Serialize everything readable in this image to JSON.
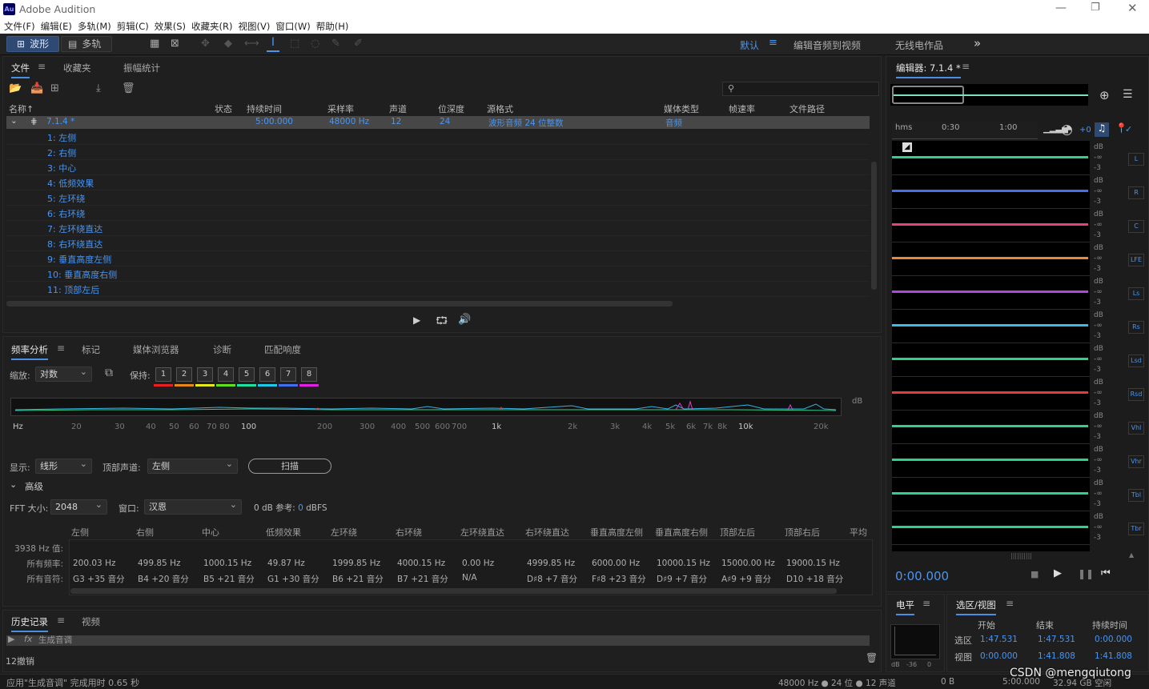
{
  "app": {
    "logo": "Au",
    "title": "Adobe Audition"
  },
  "menu": [
    "文件(F)",
    "编辑(E)",
    "多轨(M)",
    "剪辑(C)",
    "效果(S)",
    "收藏夹(R)",
    "视图(V)",
    "窗口(W)",
    "帮助(H)"
  ],
  "toolbar": {
    "waveform": "波形",
    "multitrack": "多轨",
    "workspace_default": "默认",
    "workspace_edit_video": "编辑音频到视频",
    "workspace_radio": "无线电作品",
    "more": "»"
  },
  "files_panel": {
    "tabs": [
      "文件",
      "收藏夹",
      "振幅统计"
    ],
    "columns": [
      "名称↑",
      "状态",
      "持续时间",
      "采样率",
      "声道",
      "位深度",
      "源格式",
      "媒体类型",
      "帧速率",
      "文件路径"
    ],
    "main_row": {
      "name": "7.1.4 *",
      "duration": "5:00.000",
      "rate": "48000 Hz",
      "channels": "12",
      "depth": "24",
      "format": "波形音频 24 位整数",
      "type": "音频"
    },
    "channels": [
      "1: 左侧",
      "2: 右侧",
      "3: 中心",
      "4: 低频效果",
      "5: 左环绕",
      "6: 右环绕",
      "7: 左环绕直达",
      "8: 右环绕直达",
      "9: 垂直高度左侧",
      "10: 垂直高度右侧",
      "11: 顶部左后"
    ]
  },
  "freq_panel": {
    "tabs": [
      "频率分析",
      "标记",
      "媒体浏览器",
      "诊断",
      "匹配响度"
    ],
    "scale_label": "缩放:",
    "scale_value": "对数",
    "hold_label": "保持:",
    "hold_buttons": [
      "1",
      "2",
      "3",
      "4",
      "5",
      "6",
      "7",
      "8"
    ],
    "axis_ticks": [
      "Hz",
      "20",
      "30",
      "40",
      "50",
      "60",
      "70",
      "80",
      "100",
      "200",
      "300",
      "400",
      "500",
      "600",
      "700",
      "1k",
      "2k",
      "3k",
      "4k",
      "5k",
      "6k",
      "7k",
      "8k",
      "10k",
      "20k"
    ],
    "db_label": "dB",
    "display_label": "显示:",
    "display_value": "线形",
    "top_channel_label": "顶部声道:",
    "top_channel_value": "左侧",
    "scan": "扫描",
    "advanced": "高级",
    "fft_label": "FFT 大小:",
    "fft_value": "2048",
    "window_label": "窗口:",
    "window_value": "汉恩",
    "ref_label": "0 dB 参考:",
    "ref_value": "0",
    "ref_unit": "dBFS",
    "table_headers": [
      "左侧",
      "右侧",
      "中心",
      "低频效果",
      "左环绕",
      "右环绕",
      "左环绕直达",
      "右环绕直达",
      "垂直高度左侧",
      "垂直高度右侧",
      "顶部左后",
      "顶部右后",
      "平均"
    ],
    "row_labels": [
      "3938 Hz 值:",
      "所有频率:",
      "所有音符:"
    ],
    "freqs": [
      "200.03 Hz",
      "499.85 Hz",
      "1000.15 Hz",
      "49.87 Hz",
      "1999.85 Hz",
      "4000.15 Hz",
      "0.00 Hz",
      "4999.85 Hz",
      "6000.00 Hz",
      "10000.15 Hz",
      "15000.00 Hz",
      "19000.15 Hz"
    ],
    "notes": [
      "G3 +35 音分",
      "B4 +20 音分",
      "B5 +21 音分",
      "G1 +30 音分",
      "B6 +21 音分",
      "B7 +21 音分",
      "N/A",
      "D♯8 +7 音分",
      "F♯8 +23 音分",
      "D♯9 +7 音分",
      "A♯9 +9 音分",
      "D10 +18 音分"
    ]
  },
  "history_panel": {
    "tabs": [
      "历史记录",
      "视频"
    ],
    "item": "生成音调",
    "undo": "12撤销"
  },
  "status": {
    "message": "应用\"生成音调\" 完成用时 0.65 秒",
    "format": "48000 Hz ● 24 位 ● 12 声道",
    "size": "0 B",
    "duration": "5:00.000",
    "free": "32.94 GB 空闲"
  },
  "editor": {
    "title": "编辑器: 7.1.4 *",
    "ruler": [
      "hms",
      "0:30",
      "1:00"
    ],
    "gain": "+0",
    "time": "0:00.000",
    "db_lines": [
      "dB",
      "-∞",
      "-3"
    ],
    "channels": [
      {
        "label": "L",
        "color": "#2fd08a"
      },
      {
        "label": "R",
        "color": "#4a6cf0"
      },
      {
        "label": "C",
        "color": "#e8407a"
      },
      {
        "label": "LFE",
        "color": "#e8883a"
      },
      {
        "label": "Ls",
        "color": "#b048e0"
      },
      {
        "label": "Rs",
        "color": "#40b8e8"
      },
      {
        "label": "Lsd",
        "color": "#2fd08a"
      },
      {
        "label": "Rsd",
        "color": "#e83a3a"
      },
      {
        "label": "Vhl",
        "color": "#2fd08a"
      },
      {
        "label": "Vhr",
        "color": "#2fd08a"
      },
      {
        "label": "Tbl",
        "color": "#2fd08a"
      },
      {
        "label": "Tbr",
        "color": "#2fd08a"
      }
    ]
  },
  "level_panel": {
    "title": "电平",
    "scale": [
      "dB",
      "-36",
      "0"
    ]
  },
  "selection_panel": {
    "title": "选区/视图",
    "headers": [
      "开始",
      "结束",
      "持续时间"
    ],
    "rows": [
      {
        "label": "选区",
        "start": "1:47.531",
        "end": "1:47.531",
        "duration": "0:00.000"
      },
      {
        "label": "视图",
        "start": "0:00.000",
        "end": "1:41.808",
        "duration": "1:41.808"
      }
    ]
  },
  "watermark": "CSDN @mengqiutong",
  "hold_colors": [
    "#e82020",
    "#e8881a",
    "#e8e820",
    "#60e020",
    "#20e0a0",
    "#20c8e8",
    "#4070f0",
    "#e020e0"
  ]
}
